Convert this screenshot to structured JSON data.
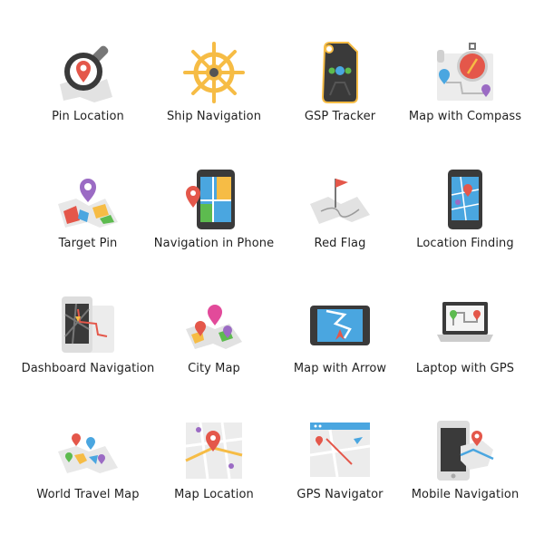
{
  "icons": [
    {
      "label": "Pin Location",
      "icon": "magnifier-pin-icon"
    },
    {
      "label": "Ship Navigation",
      "icon": "ship-wheel-icon"
    },
    {
      "label": "GSP Tracker",
      "icon": "tracker-device-icon"
    },
    {
      "label": "Map with Compass",
      "icon": "map-compass-icon"
    },
    {
      "label": "Target Pin",
      "icon": "map-pin-icon"
    },
    {
      "label": "Navigation in Phone",
      "icon": "phone-navigation-icon"
    },
    {
      "label": "Red Flag",
      "icon": "map-flag-icon"
    },
    {
      "label": "Location Finding",
      "icon": "phone-map-icon"
    },
    {
      "label": "Dashboard Navigation",
      "icon": "tablet-route-icon"
    },
    {
      "label": "City Map",
      "icon": "city-map-pins-icon"
    },
    {
      "label": "Map with Arrow",
      "icon": "tablet-arrow-icon"
    },
    {
      "label": "Laptop with GPS",
      "icon": "laptop-gps-icon"
    },
    {
      "label": "World Travel Map",
      "icon": "world-map-pins-icon"
    },
    {
      "label": "Map Location",
      "icon": "map-location-icon"
    },
    {
      "label": "GPS Navigator",
      "icon": "browser-map-icon"
    },
    {
      "label": "Mobile Navigation",
      "icon": "mobile-map-icon"
    }
  ],
  "colors": {
    "red": "#e4574a",
    "yellow": "#f6bc45",
    "dark": "#3a3a3a",
    "blue": "#4aa6e0",
    "purple": "#9b6bc4",
    "green": "#5dbb4f",
    "map": "#e8e8e8"
  }
}
